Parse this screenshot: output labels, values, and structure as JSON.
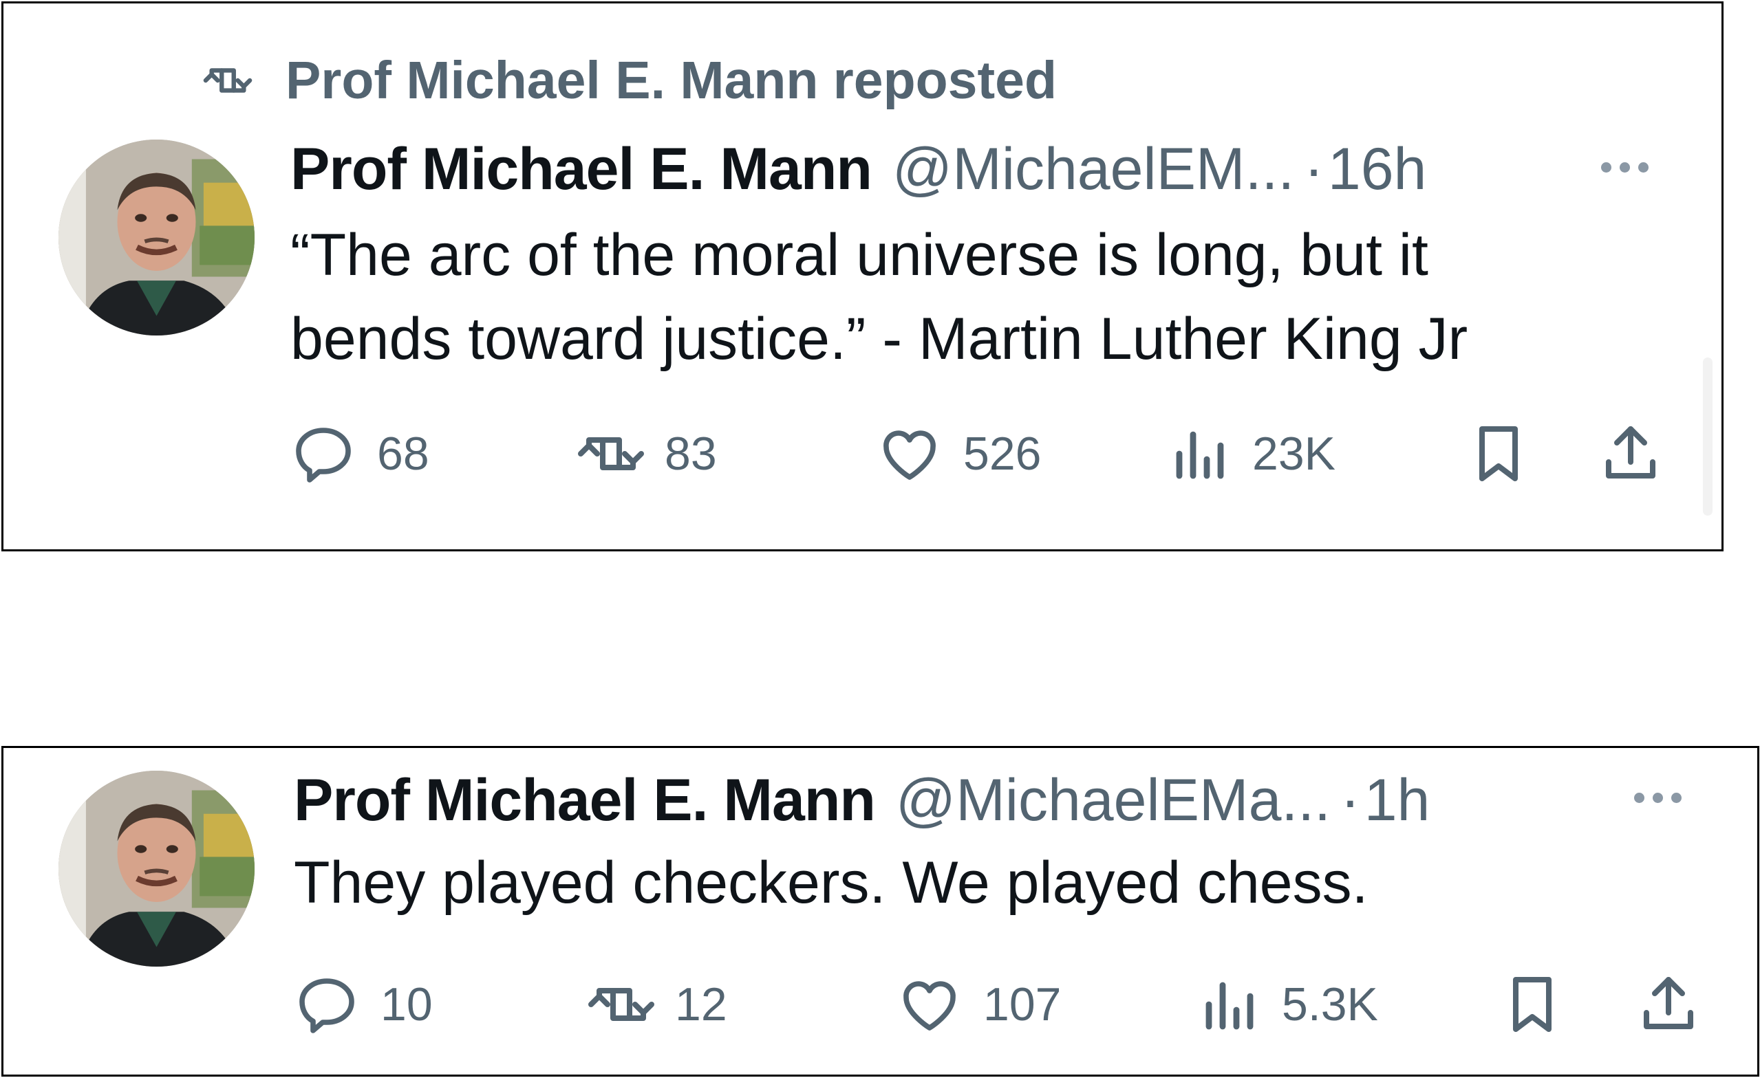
{
  "colors": {
    "text": "#0f1419",
    "muted": "#536471",
    "border": "#000000"
  },
  "tweets": [
    {
      "repost_label": "Prof Michael E. Mann reposted",
      "name": "Prof Michael E. Mann",
      "handle": "@MichaelEM...",
      "separator": "·",
      "time": "16h",
      "text": "“The arc of the moral universe is long, but it\nbends toward justice.” - Martin Luther King Jr",
      "replies": "68",
      "reposts": "83",
      "likes": "526",
      "views": "23K",
      "icons": [
        "repost-icon",
        "reply-icon",
        "like-icon",
        "views-icon",
        "bookmark-icon",
        "share-icon",
        "more-icon"
      ]
    },
    {
      "name": "Prof Michael E. Mann",
      "handle": "@MichaelEMa...",
      "separator": "·",
      "time": "1h",
      "text": "They played checkers. We played chess.",
      "replies": "10",
      "reposts": "12",
      "likes": "107",
      "views": "5.3K",
      "icons": [
        "reply-icon",
        "like-icon",
        "views-icon",
        "bookmark-icon",
        "share-icon",
        "more-icon"
      ]
    }
  ]
}
